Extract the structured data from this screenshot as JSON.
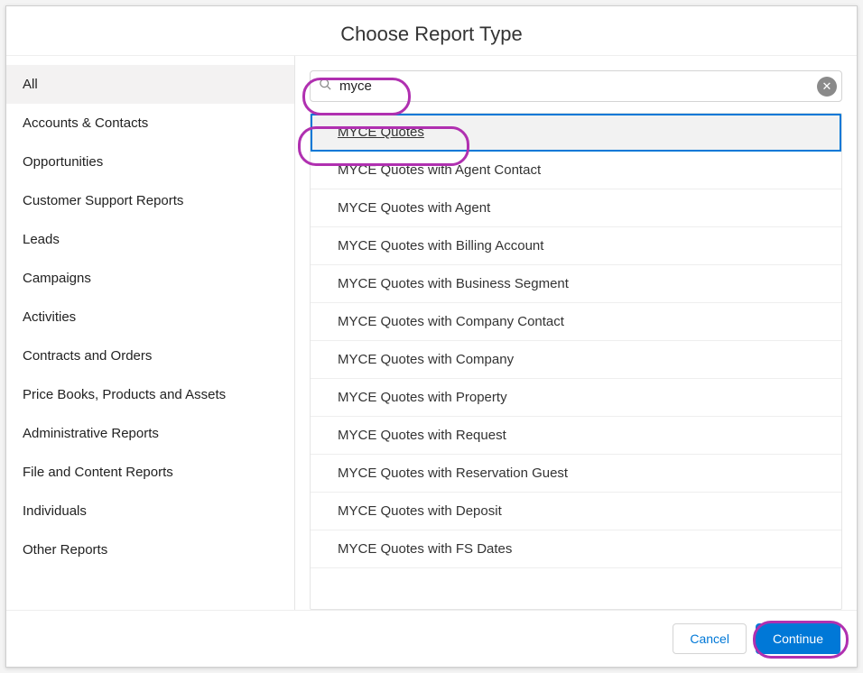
{
  "header": {
    "title": "Choose Report Type"
  },
  "sidebar": {
    "items": [
      {
        "label": "All",
        "active": true
      },
      {
        "label": "Accounts & Contacts"
      },
      {
        "label": "Opportunities"
      },
      {
        "label": "Customer Support Reports"
      },
      {
        "label": "Leads"
      },
      {
        "label": "Campaigns"
      },
      {
        "label": "Activities"
      },
      {
        "label": "Contracts and Orders"
      },
      {
        "label": "Price Books, Products and Assets"
      },
      {
        "label": "Administrative Reports"
      },
      {
        "label": "File and Content Reports"
      },
      {
        "label": "Individuals"
      },
      {
        "label": "Other Reports"
      }
    ]
  },
  "search": {
    "value": "myce",
    "clear_label": "✕"
  },
  "results": [
    {
      "label": "MYCE Quotes",
      "selected": true
    },
    {
      "label": "MYCE Quotes with Agent Contact"
    },
    {
      "label": "MYCE Quotes with Agent"
    },
    {
      "label": "MYCE Quotes with Billing Account"
    },
    {
      "label": "MYCE Quotes with Business Segment"
    },
    {
      "label": "MYCE Quotes with Company Contact"
    },
    {
      "label": "MYCE Quotes with Company"
    },
    {
      "label": "MYCE Quotes with Property"
    },
    {
      "label": "MYCE Quotes with Request"
    },
    {
      "label": "MYCE Quotes with Reservation Guest"
    },
    {
      "label": "MYCE Quotes with Deposit"
    },
    {
      "label": "MYCE Quotes with FS Dates"
    }
  ],
  "footer": {
    "cancel_label": "Cancel",
    "continue_label": "Continue"
  }
}
